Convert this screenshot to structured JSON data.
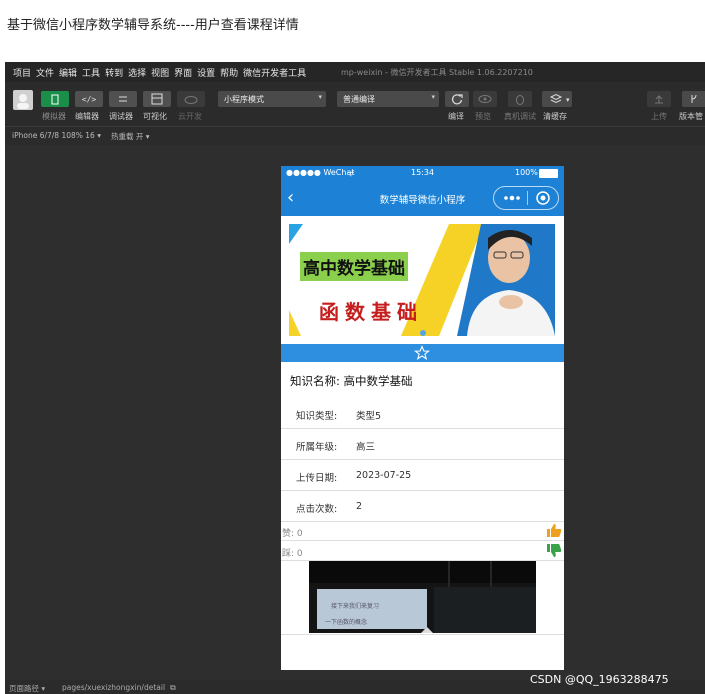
{
  "page": {
    "title": "基于微信小程序数学辅导系统----用户查看课程详情"
  },
  "ide": {
    "menu": [
      "项目",
      "文件",
      "编辑",
      "工具",
      "转到",
      "选择",
      "视图",
      "界面",
      "设置",
      "帮助",
      "微信开发者工具"
    ],
    "project_name": "mp-weixin",
    "version_text": "- 微信开发者工具 Stable 1.06.2207210",
    "toolbar": {
      "simulator": "模拟器",
      "editor": "编辑器",
      "debugger": "调试器",
      "visual": "可视化",
      "cloud": "云开发",
      "mode_select": "小程序模式",
      "compile_select": "普通编译",
      "compile": "编译",
      "preview": "预览",
      "remote_debug": "真机调试",
      "clear_cache": "清缓存",
      "upload": "上传",
      "version_mgmt": "版本管"
    },
    "device_label": "iPhone 6/7/8 108% 16 ▾",
    "hotreload_label": "热重载 开 ▾",
    "footer_path_label": "页面路径 ▾",
    "footer_path": "pages/xuexizhongxin/detail"
  },
  "phone": {
    "carrier": "●●●●● WeChat",
    "time": "15:34",
    "battery": "100%",
    "nav_title": "数学辅导微信小程序",
    "banner_title": "高中数学基础",
    "banner_subtitle": "函数基础",
    "knowledge_name_label": "知识名称:",
    "knowledge_name": "高中数学基础",
    "rows": [
      {
        "label": "知识类型:",
        "value": "类型5"
      },
      {
        "label": "所属年级:",
        "value": "高三"
      },
      {
        "label": "上传日期:",
        "value": "2023-07-25"
      },
      {
        "label": "点击次数:",
        "value": "2"
      }
    ],
    "likes": "赞: 0",
    "dislikes": "踩: 0",
    "video_slide_line1": "接下来我们来复习",
    "video_slide_line2": "一下函数的概念"
  },
  "watermark": "CSDN @QQ_1963288475",
  "colors": {
    "accent": "#1d82d6",
    "ide_bg": "#2e2e2e",
    "thumb_up": "#f0a020",
    "thumb_down": "#3aa34a"
  }
}
